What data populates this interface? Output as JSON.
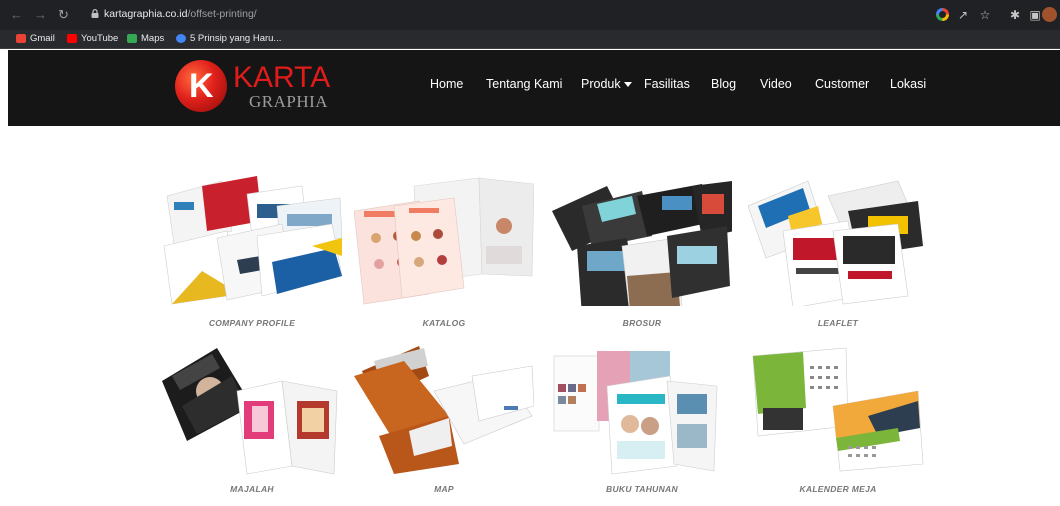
{
  "browser": {
    "url_host": "kartagraphia.co.id",
    "url_path": "/offset-printing/",
    "bookmarks": [
      {
        "label": "Gmail",
        "color": "#ea4335"
      },
      {
        "label": "YouTube",
        "color": "#ff0000"
      },
      {
        "label": "Maps",
        "color": "#34a853"
      },
      {
        "label": "5 Prinsip yang Haru...",
        "color": "#4285f4"
      }
    ]
  },
  "site": {
    "logo_letter": "K",
    "logo_title": "KARTA",
    "logo_subtitle": "GRAPHIA",
    "menu": [
      {
        "label": "Home"
      },
      {
        "label": "Tentang Kami"
      },
      {
        "label": "Produk"
      },
      {
        "label": "Fasilitas"
      },
      {
        "label": "Blog"
      },
      {
        "label": "Video"
      },
      {
        "label": "Customer"
      },
      {
        "label": "Lokasi"
      }
    ]
  },
  "products": [
    {
      "label": "COMPANY PROFILE"
    },
    {
      "label": "KATALOG"
    },
    {
      "label": "BROSUR"
    },
    {
      "label": "LEAFLET"
    },
    {
      "label": "MAJALAH"
    },
    {
      "label": "MAP"
    },
    {
      "label": "BUKU TAHUNAN"
    },
    {
      "label": "KALENDER MEJA"
    }
  ]
}
